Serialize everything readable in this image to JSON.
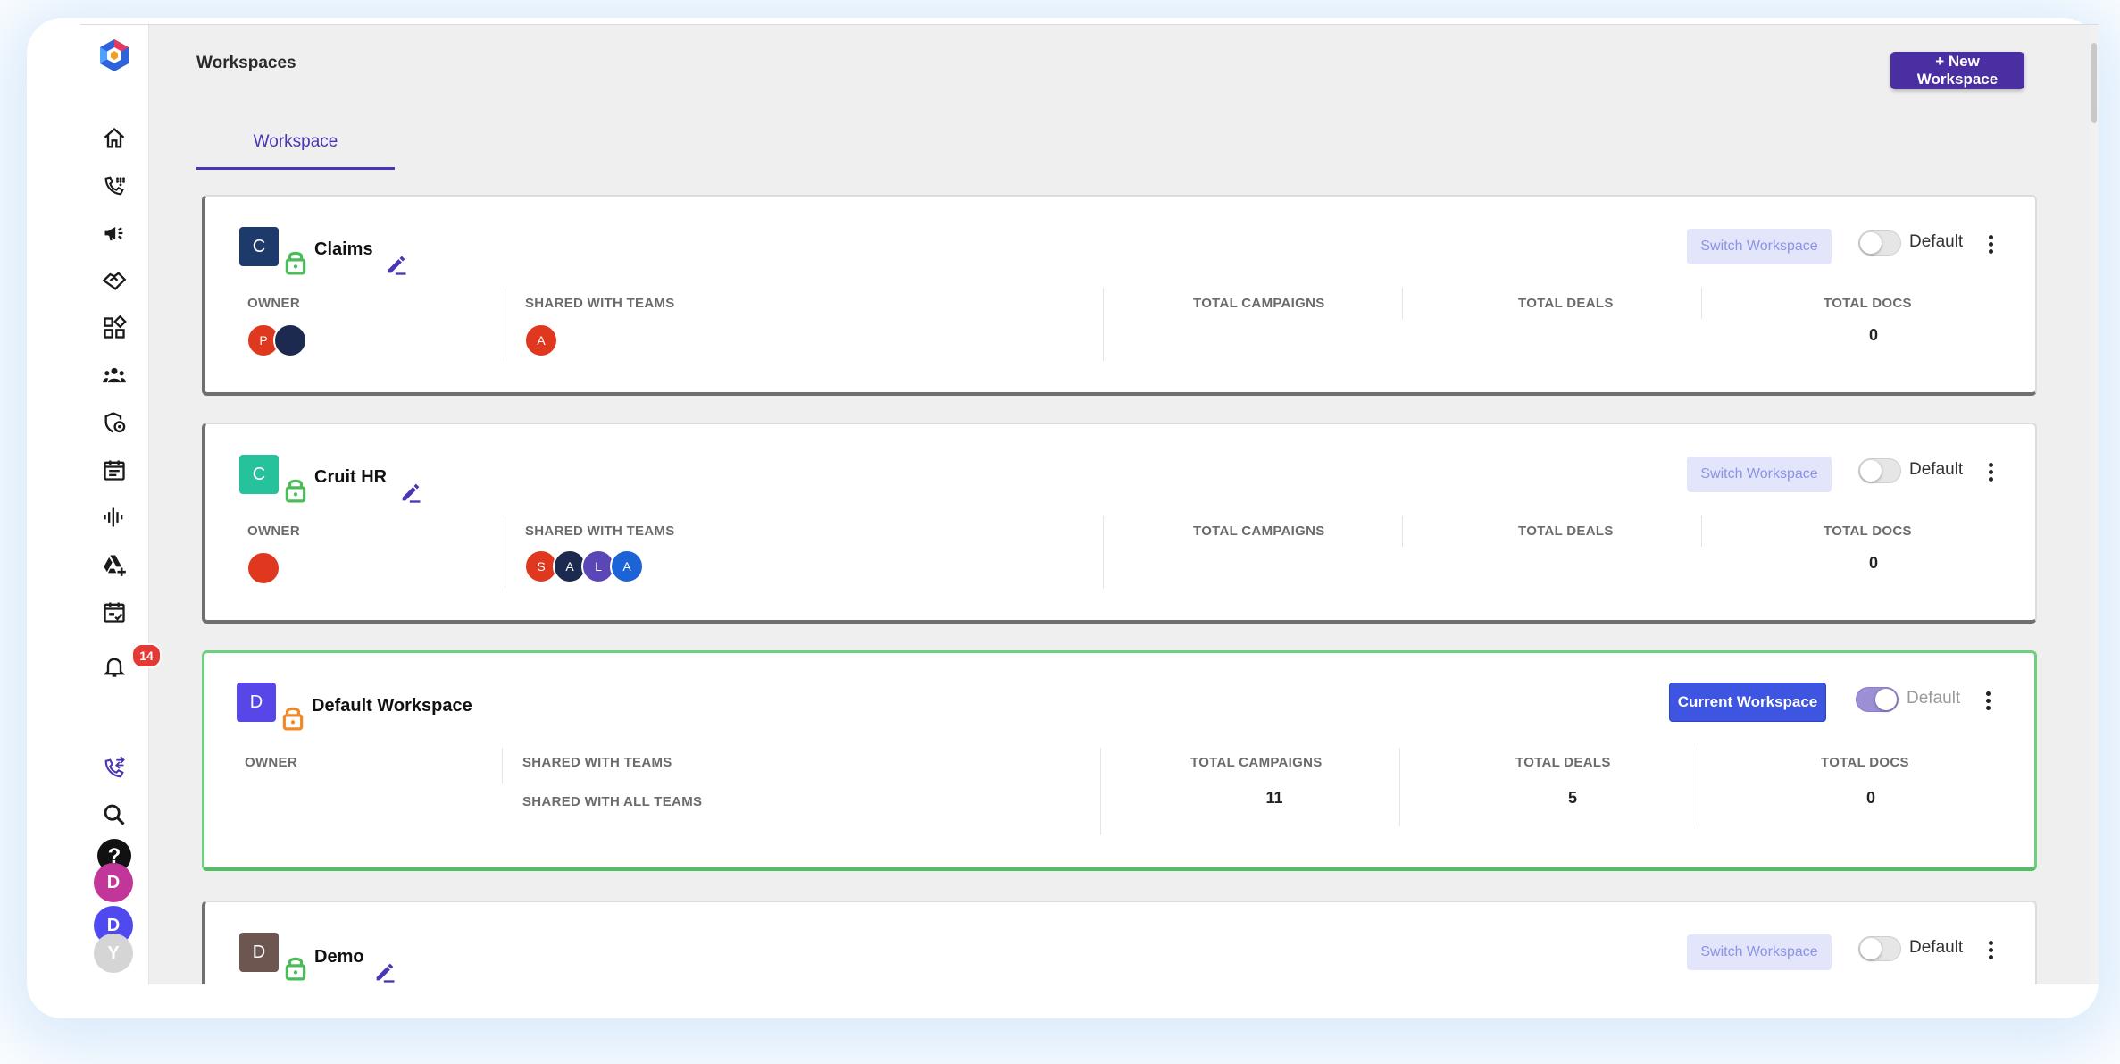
{
  "header": {
    "title": "Workspaces",
    "new_workspace_label": "+ New Workspace"
  },
  "tabs": [
    {
      "label": "Workspace",
      "active": true
    }
  ],
  "sidebar": {
    "items": [
      {
        "icon": "home-icon"
      },
      {
        "icon": "dialpad-icon"
      },
      {
        "icon": "megaphone-icon"
      },
      {
        "icon": "handshake-icon"
      },
      {
        "icon": "apps-grid-icon"
      },
      {
        "icon": "team-icon"
      },
      {
        "icon": "security-icon"
      },
      {
        "icon": "calendar-icon"
      },
      {
        "icon": "audio-wave-icon"
      },
      {
        "icon": "drive-add-icon"
      },
      {
        "icon": "calendar-check-icon"
      },
      {
        "icon": "bell-icon",
        "badge": "14"
      }
    ],
    "bottom": [
      {
        "icon": "phone-forward-icon"
      },
      {
        "icon": "search-icon"
      },
      {
        "icon": "help-icon"
      }
    ],
    "avatars": [
      {
        "initial": "D",
        "color": "#c2369a"
      },
      {
        "initial": "D",
        "color": "#4e4af0"
      },
      {
        "initial": "Y",
        "color": "#d5d5d5"
      }
    ]
  },
  "labels": {
    "owner": "OWNER",
    "shared_with_teams": "SHARED WITH TEAMS",
    "total_campaigns": "TOTAL CAMPAIGNS",
    "total_deals": "TOTAL DEALS",
    "total_docs": "TOTAL DOCS",
    "switch_workspace": "Switch Workspace",
    "current_workspace": "Current Workspace",
    "default": "Default"
  },
  "workspaces": [
    {
      "initial": "C",
      "name": "Claims",
      "color": "#1e3a6b",
      "lock_color": "#4cbb5a",
      "owners": [
        {
          "initial": "P",
          "color": "#e0381f"
        },
        {
          "initial": "",
          "color": "#1c2a4f"
        }
      ],
      "shared_teams": [
        {
          "initial": "A",
          "color": "#e0381f"
        }
      ],
      "shared_all_teams": "",
      "total_campaigns": "",
      "total_deals": "",
      "total_docs": "0",
      "is_current": false,
      "is_default": false
    },
    {
      "initial": "C",
      "name": "Cruit HR",
      "color": "#26c29c",
      "lock_color": "#4cbb5a",
      "owners": [
        {
          "initial": "",
          "color": "#e0381f"
        }
      ],
      "shared_teams": [
        {
          "initial": "S",
          "color": "#e0381f"
        },
        {
          "initial": "A",
          "color": "#1c2a4f"
        },
        {
          "initial": "L",
          "color": "#5b46b8"
        },
        {
          "initial": "A",
          "color": "#1b63d6"
        }
      ],
      "shared_all_teams": "",
      "total_campaigns": "",
      "total_deals": "",
      "total_docs": "0",
      "is_current": false,
      "is_default": false
    },
    {
      "initial": "D",
      "name": "Default Workspace",
      "color": "#5747e8",
      "lock_color": "#f0892a",
      "owners": [],
      "shared_teams": [],
      "shared_all_teams": "SHARED WITH ALL TEAMS",
      "total_campaigns": "11",
      "total_deals": "5",
      "total_docs": "0",
      "is_current": true,
      "is_default": true
    },
    {
      "initial": "D",
      "name": "Demo",
      "color": "#6d5550",
      "lock_color": "#4cbb5a",
      "owners": [],
      "shared_teams": [],
      "shared_all_teams": "",
      "total_campaigns": "",
      "total_deals": "",
      "total_docs": "",
      "is_current": false,
      "is_default": false
    }
  ]
}
